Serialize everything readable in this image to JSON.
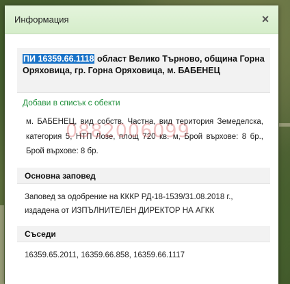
{
  "dialog": {
    "title": "Информация",
    "close_label": "×"
  },
  "property": {
    "id": "ПИ 16359.66.1118",
    "location": " област Велико Търново, община Горна Оряховица, гр. Горна Оряховица, м. БАБЕНЕЦ",
    "add_link": "Добави в списък с обекти",
    "description": "м. БАБЕНЕЦ, вид собств. Частна, вид територия Земеделска, категория 5, НТП Лозе, площ 720 кв. м, Брой върхове: 8 бр., Брой върхове: 8 бр.",
    "watermark": "0882006099"
  },
  "order": {
    "heading": "Основна заповед",
    "text": "Заповед за одобрение на КККР РД-18-1539/31.08.2018 г., издадена от ИЗПЪЛНИТЕЛЕН ДИРЕКТОР НА АГКК"
  },
  "neighbors": {
    "heading": "Съседи",
    "text": "16359.65.2011, 16359.66.858, 16359.66.1117"
  }
}
